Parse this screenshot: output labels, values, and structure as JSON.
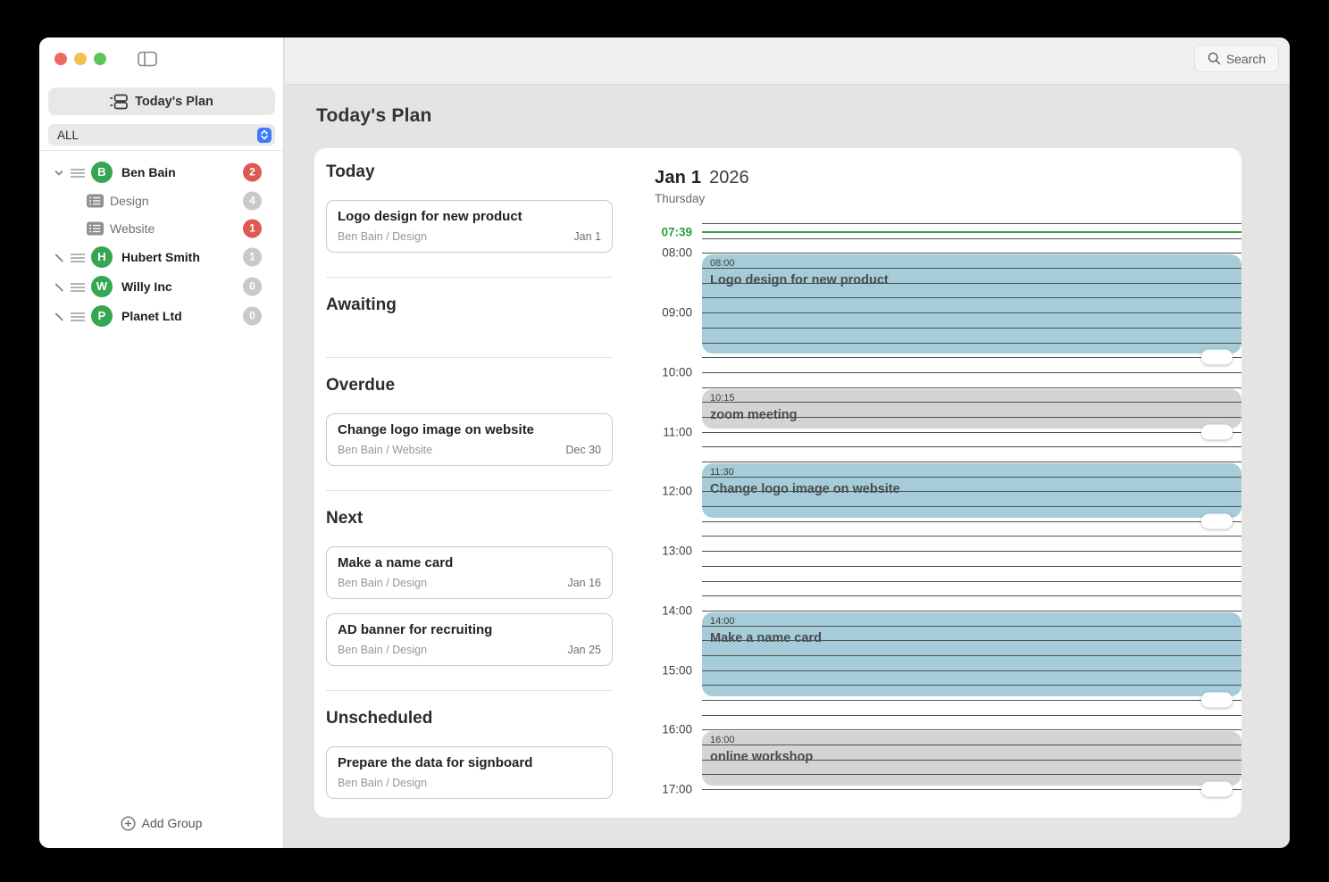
{
  "window": {
    "traffic_lights": [
      {
        "name": "close",
        "color": "#ee6a5f"
      },
      {
        "name": "minimize",
        "color": "#f5bf4f"
      },
      {
        "name": "zoom",
        "color": "#61c554"
      }
    ]
  },
  "toolbar": {
    "search_label": "Search"
  },
  "sidebar": {
    "plan_button_label": "Today's Plan",
    "filter_value": "ALL",
    "groups": [
      {
        "name": "Ben Bain",
        "initial": "B",
        "badge": "2",
        "badge_color": "red",
        "expanded": true,
        "children": [
          {
            "name": "Design",
            "badge": "4",
            "badge_color": "gray"
          },
          {
            "name": "Website",
            "badge": "1",
            "badge_color": "red"
          }
        ]
      },
      {
        "name": "Hubert Smith",
        "initial": "H",
        "badge": "1",
        "badge_color": "gray",
        "expanded": false,
        "children": []
      },
      {
        "name": "Willy Inc",
        "initial": "W",
        "badge": "0",
        "badge_color": "gray",
        "expanded": false,
        "children": []
      },
      {
        "name": "Planet Ltd",
        "initial": "P",
        "badge": "0",
        "badge_color": "gray",
        "expanded": false,
        "children": []
      }
    ],
    "add_group_label": "Add Group"
  },
  "main": {
    "title": "Today's Plan",
    "sections": [
      {
        "title": "Today",
        "tasks": [
          {
            "title": "Logo design for new product",
            "meta": "Ben Bain / Design",
            "date": "Jan 1"
          }
        ]
      },
      {
        "title": "Awaiting",
        "tasks": []
      },
      {
        "title": "Overdue",
        "tasks": [
          {
            "title": "Change logo image on website",
            "meta": "Ben Bain / Website",
            "date": "Dec 30"
          }
        ]
      },
      {
        "title": "Next",
        "tasks": [
          {
            "title": "Make a name card",
            "meta": "Ben Bain / Design",
            "date": "Jan 16"
          },
          {
            "title": "AD banner for recruiting",
            "meta": "Ben Bain / Design",
            "date": "Jan 25"
          }
        ]
      },
      {
        "title": "Unscheduled",
        "tasks": [
          {
            "title": "Prepare the data for signboard",
            "meta": "Ben Bain / Design",
            "date": ""
          }
        ]
      }
    ]
  },
  "calendar": {
    "date_day": "Jan 1",
    "date_year": "2026",
    "weekday": "Thursday",
    "current_time": "07:39",
    "hour_labels": [
      "08:00",
      "09:00",
      "10:00",
      "11:00",
      "12:00",
      "13:00",
      "14:00",
      "15:00",
      "16:00",
      "17:00"
    ],
    "events": [
      {
        "time_label": "08:00",
        "title": "Logo design for new product",
        "start": "08:00",
        "end": "09:45",
        "variant": "blue"
      },
      {
        "time_label": "10:15",
        "title": "zoom meeting",
        "start": "10:15",
        "end": "11:00",
        "variant": "gray"
      },
      {
        "time_label": "11:30",
        "title": "Change logo image on website",
        "start": "11:30",
        "end": "12:30",
        "variant": "blue"
      },
      {
        "time_label": "14:00",
        "title": "Make a name card",
        "start": "14:00",
        "end": "15:30",
        "variant": "blue"
      },
      {
        "time_label": "16:00",
        "title": "online workshop",
        "start": "16:00",
        "end": "17:00",
        "variant": "gray"
      }
    ]
  },
  "colors": {
    "badge_red": "#dc5a50",
    "badge_gray": "#c9c9c9",
    "avatar_green": "#35a750",
    "event_blue": "#a5ccd8",
    "event_gray": "#d4d4d3",
    "current_time_green": "#28a43c",
    "select_blue": "#3e7bf7"
  }
}
